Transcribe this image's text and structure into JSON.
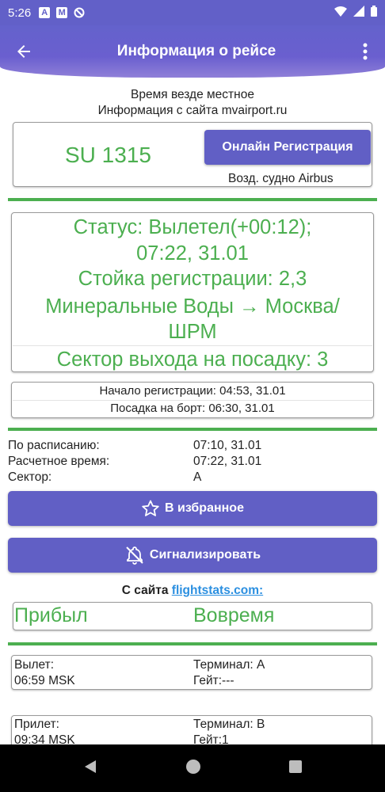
{
  "status_bar": {
    "time": "5:26",
    "icon_a": "A",
    "icon_m": "M"
  },
  "app_bar": {
    "title": "Информация о рейсе"
  },
  "notes": {
    "local_time": "Время везде местное",
    "source": "Информация с сайта mvairport.ru"
  },
  "flight": {
    "number": "SU 1315",
    "online_checkin": "Онлайн Регистрация",
    "aircraft": "Возд. судно Airbus"
  },
  "status": {
    "line1": "Статус: Вылетел(+00:12);",
    "line2": "07:22, 31.01",
    "checkin_desk": "Стойка регистрации: 2,3",
    "route_line1": "Минеральные Воды → Москва/",
    "route_line2": "ШРМ",
    "gate_sector": "Сектор выхода на посадку: 3"
  },
  "times": {
    "checkin_start": "Начало регистрации: 04:53, 31.01",
    "boarding": "Посадка на борт: 06:30, 31.01"
  },
  "schedule": [
    {
      "label": "По расписанию:",
      "value": "07:10, 31.01"
    },
    {
      "label": "Расчетное время:",
      "value": "07:22, 31.01"
    },
    {
      "label": "Сектор:",
      "value": "A"
    }
  ],
  "buttons": {
    "favorite": "В избранное",
    "alert": "Сигнализировать"
  },
  "flightstats": {
    "prefix": "С сайта",
    "link": "flightstats.com:",
    "state": "Прибыл",
    "punctuality": "Вовремя"
  },
  "departure": {
    "label": "Вылет:",
    "time": "06:59 MSK",
    "terminal": "Терминал: A",
    "gate": "Гейт:---"
  },
  "arrival": {
    "label": "Прилет:",
    "time": "09:34 MSK",
    "terminal": "Терминал: B",
    "gate": "Гейт:1"
  },
  "colors": {
    "accent": "#615fc5",
    "status_green": "#4caf50",
    "link": "#2b8fe0"
  }
}
